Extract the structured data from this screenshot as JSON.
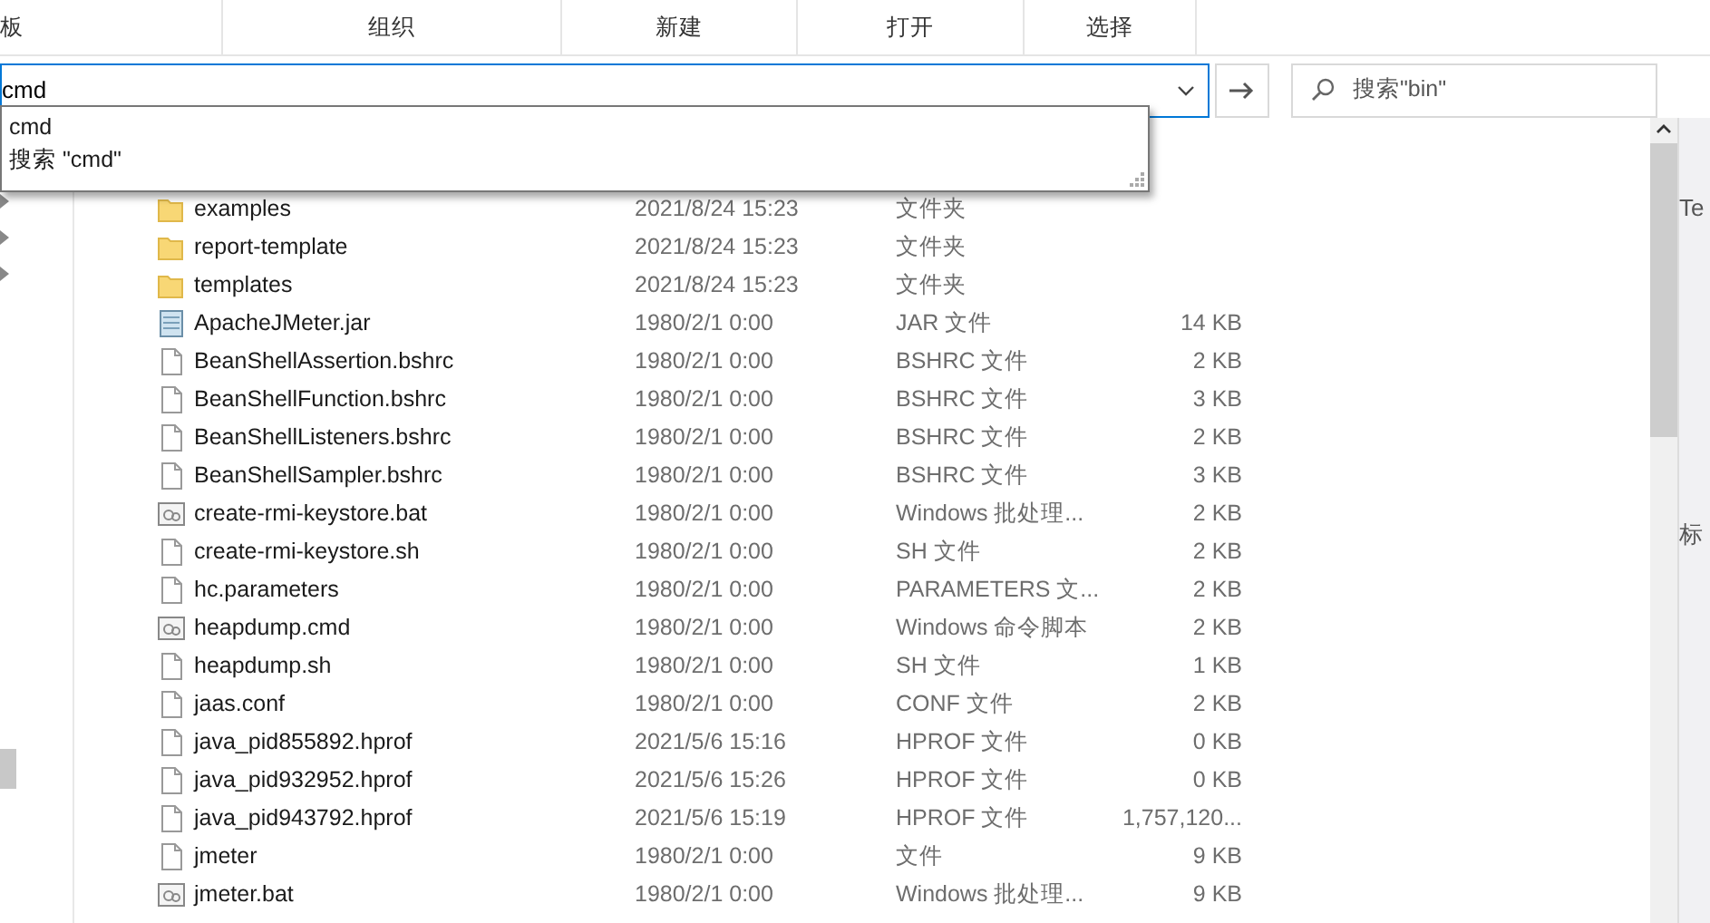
{
  "ribbon": {
    "groups": [
      "板",
      "组织",
      "新建",
      "打开",
      "选择"
    ]
  },
  "address": {
    "value": "cmd"
  },
  "search": {
    "placeholder": "搜索\"bin\""
  },
  "suggestions": [
    "cmd",
    "搜索 \"cmd\""
  ],
  "files": [
    {
      "name": "examples",
      "date": "2021/8/24 15:23",
      "type": "文件夹",
      "kind": "folder"
    },
    {
      "name": "report-template",
      "date": "2021/8/24 15:23",
      "type": "文件夹",
      "kind": "folder"
    },
    {
      "name": "templates",
      "date": "2021/8/24 15:23",
      "type": "文件夹",
      "kind": "folder"
    },
    {
      "name": "ApacheJMeter.jar",
      "date": "1980/2/1 0:00",
      "type": "JAR 文件",
      "size": "14 KB",
      "kind": "jar"
    },
    {
      "name": "BeanShellAssertion.bshrc",
      "date": "1980/2/1 0:00",
      "type": "BSHRC 文件",
      "size": "2 KB",
      "kind": "file"
    },
    {
      "name": "BeanShellFunction.bshrc",
      "date": "1980/2/1 0:00",
      "type": "BSHRC 文件",
      "size": "3 KB",
      "kind": "file"
    },
    {
      "name": "BeanShellListeners.bshrc",
      "date": "1980/2/1 0:00",
      "type": "BSHRC 文件",
      "size": "2 KB",
      "kind": "file"
    },
    {
      "name": "BeanShellSampler.bshrc",
      "date": "1980/2/1 0:00",
      "type": "BSHRC 文件",
      "size": "3 KB",
      "kind": "file"
    },
    {
      "name": "create-rmi-keystore.bat",
      "date": "1980/2/1 0:00",
      "type": "Windows 批处理...",
      "size": "2 KB",
      "kind": "script"
    },
    {
      "name": "create-rmi-keystore.sh",
      "date": "1980/2/1 0:00",
      "type": "SH 文件",
      "size": "2 KB",
      "kind": "file"
    },
    {
      "name": "hc.parameters",
      "date": "1980/2/1 0:00",
      "type": "PARAMETERS 文...",
      "size": "2 KB",
      "kind": "file"
    },
    {
      "name": "heapdump.cmd",
      "date": "1980/2/1 0:00",
      "type": "Windows 命令脚本",
      "size": "2 KB",
      "kind": "script"
    },
    {
      "name": "heapdump.sh",
      "date": "1980/2/1 0:00",
      "type": "SH 文件",
      "size": "1 KB",
      "kind": "file"
    },
    {
      "name": "jaas.conf",
      "date": "1980/2/1 0:00",
      "type": "CONF 文件",
      "size": "2 KB",
      "kind": "file"
    },
    {
      "name": "java_pid855892.hprof",
      "date": "2021/5/6 15:16",
      "type": "HPROF 文件",
      "size": "0 KB",
      "kind": "file"
    },
    {
      "name": "java_pid932952.hprof",
      "date": "2021/5/6 15:26",
      "type": "HPROF 文件",
      "size": "0 KB",
      "kind": "file"
    },
    {
      "name": "java_pid943792.hprof",
      "date": "2021/5/6 15:19",
      "type": "HPROF 文件",
      "size": "1,757,120...",
      "kind": "file"
    },
    {
      "name": "jmeter",
      "date": "1980/2/1 0:00",
      "type": "文件",
      "size": "9 KB",
      "kind": "file"
    },
    {
      "name": "jmeter.bat",
      "date": "1980/2/1 0:00",
      "type": "Windows 批处理...",
      "size": "9 KB",
      "kind": "script"
    }
  ],
  "background_window": {
    "texts": [
      "Te",
      "标"
    ]
  }
}
